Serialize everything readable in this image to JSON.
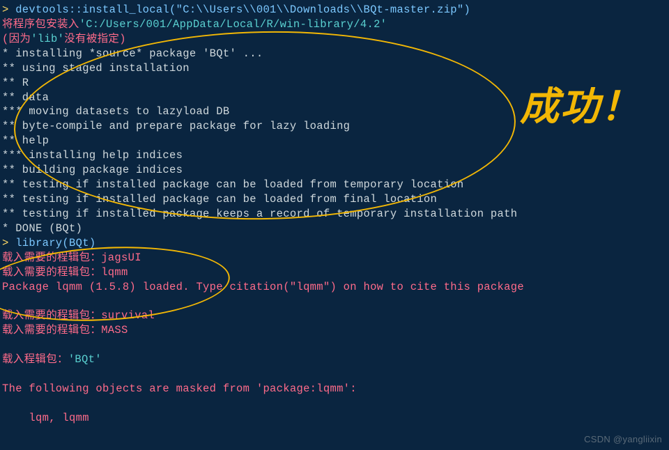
{
  "terminal": {
    "prompt": "> ",
    "cmd1": "devtools::install_local(\"C:\\\\Users\\\\001\\\\Downloads\\\\BQt-master.zip\")",
    "line2a": "将程序包安装入",
    "line2b": "'C:/Users/001/AppData/Local/R/win-library/4.2'",
    "line3a": "(因为",
    "line3b": "'lib'",
    "line3c": "没有被指定)",
    "out1": "* installing *source* package 'BQt' ...",
    "out2": "** using staged installation",
    "out3": "** R",
    "out4": "** data",
    "out5": "*** moving datasets to lazyload DB",
    "out6": "** byte-compile and prepare package for lazy loading",
    "out7": "** help",
    "out8": "*** installing help indices",
    "out9": "** building package indices",
    "out10": "** testing if installed package can be loaded from temporary location",
    "out11": "** testing if installed package can be loaded from final location",
    "out12": "** testing if installed package keeps a record of temporary installation path",
    "out13": "* DONE (BQt)",
    "cmd2": "library(BQt)",
    "load1": "载入需要的程辑包：jagsUI",
    "load2": "载入需要的程辑包：lqmm",
    "pkg_msg": "Package lqmm (1.5.8) loaded. Type citation(\"lqmm\") on how to cite this package",
    "load3": "载入需要的程辑包：survival",
    "load4": "载入需要的程辑包：MASS",
    "load5a": "载入程辑包：",
    "load5b": "'BQt'",
    "mask_msg": "The following objects are masked from 'package:lqmm':",
    "mask_items": "    lqm, lqmm"
  },
  "annotation": {
    "success_label": "成功！"
  },
  "watermark": "CSDN @yangliixin"
}
